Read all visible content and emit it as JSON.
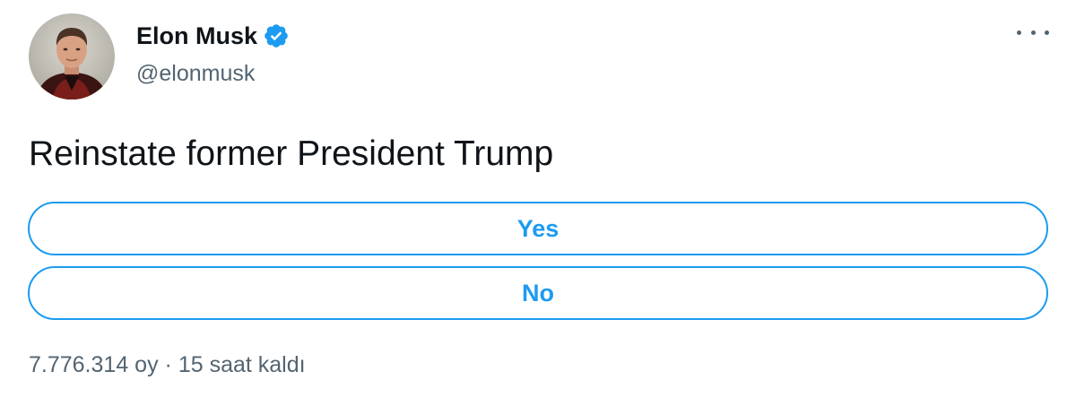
{
  "author": {
    "display_name": "Elon Musk",
    "handle": "@elonmusk",
    "verified_icon": "verified-badge-icon",
    "verified_color": "#1d9bf0"
  },
  "tweet": {
    "text": "Reinstate former President Trump"
  },
  "poll": {
    "options": [
      {
        "label": "Yes"
      },
      {
        "label": "No"
      }
    ],
    "votes": "7.776.314 oy",
    "separator": "·",
    "time_left": "15 saat kaldı",
    "accent_color": "#1d9bf0"
  },
  "menu": {
    "icon": "more-options-icon"
  }
}
